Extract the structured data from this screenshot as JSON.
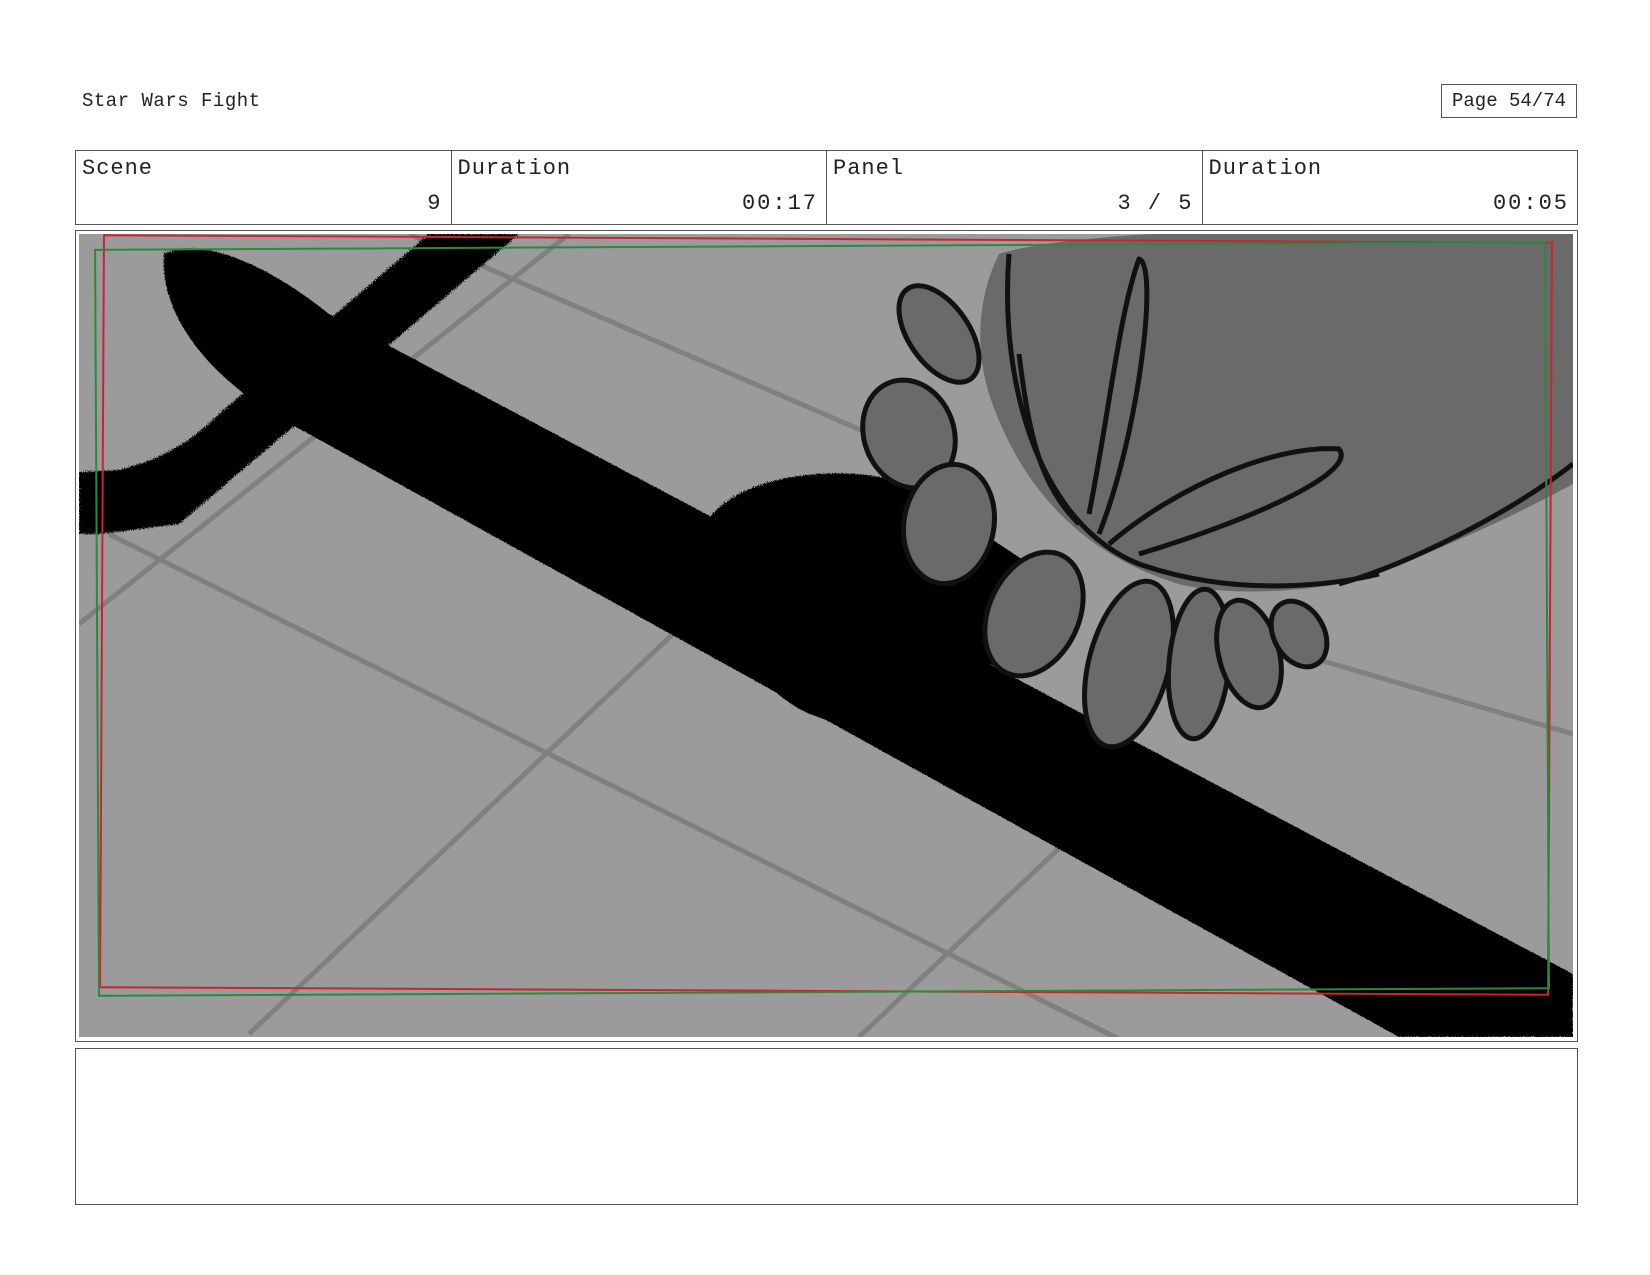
{
  "header": {
    "title": "Star Wars Fight",
    "page_label": "Page 54/74"
  },
  "info": {
    "scene_label": "Scene",
    "scene_value": "9",
    "scene_duration_label": "Duration",
    "scene_duration_value": "00:17",
    "panel_label": "Panel",
    "panel_value": "3 / 5",
    "panel_duration_label": "Duration",
    "panel_duration_value": "00:05"
  },
  "frame": {
    "background_color": "#9b9b9b",
    "shadow_color": "#000000",
    "hand_color": "#6a6a6a",
    "safe_area_red": "#cc2233",
    "safe_area_green": "#2a8a3a"
  },
  "notes": {
    "text": ""
  }
}
